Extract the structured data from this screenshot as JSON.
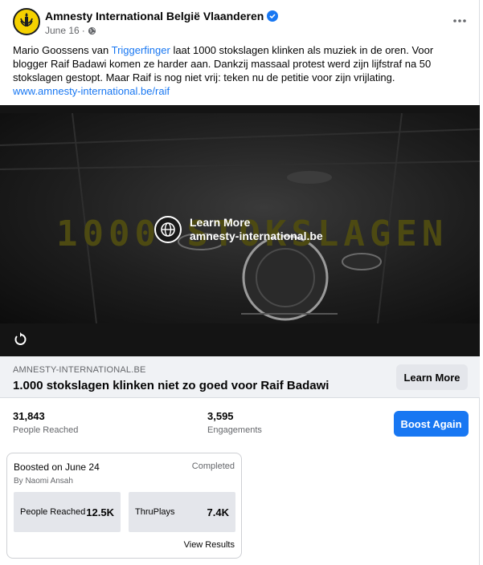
{
  "post": {
    "page_name": "Amnesty International België Vlaanderen",
    "date": "June 16",
    "separator": "·",
    "text_before": "Mario Goossens van ",
    "mention": "Triggerfinger",
    "text_after": " laat 1000 stokslagen klinken als muziek in de oren. Voor blogger Raif Badawi komen ze harder aan. Dankzij massaal protest werd zijn lijfstraf na 50 stokslagen gestopt. Maar Raif is nog niet vrij: teken nu de petitie voor zijn vrijlating.",
    "link": "www.amnesty-international.be/raif"
  },
  "video": {
    "background_title": "1000 STOKSLAGEN",
    "cta_line1": "Learn More",
    "cta_line2": "amnesty-international.be"
  },
  "link_preview": {
    "domain": "AMNESTY-INTERNATIONAL.BE",
    "headline": "1.000 stokslagen klinken niet zo goed voor Raif Badawi",
    "button": "Learn More"
  },
  "stats": {
    "people_reached_value": "31,843",
    "people_reached_label": "People Reached",
    "engagements_value": "3,595",
    "engagements_label": "Engagements",
    "boost_button": "Boost Again"
  },
  "boost_card": {
    "title": "Boosted on June 24",
    "by": "By Naomi Ansah",
    "status": "Completed",
    "metric1_label": "People Reached",
    "metric1_value": "12.5K",
    "metric2_label": "ThruPlays",
    "metric2_value": "7.4K",
    "view_results": "View Results"
  },
  "colors": {
    "accent": "#1877f2",
    "brand_yellow": "#f5d100"
  },
  "icons": [
    "amnesty-candle-logo",
    "verified-badge-icon",
    "globe-small-icon",
    "more-options-icon",
    "globe-icon",
    "replay-icon"
  ]
}
